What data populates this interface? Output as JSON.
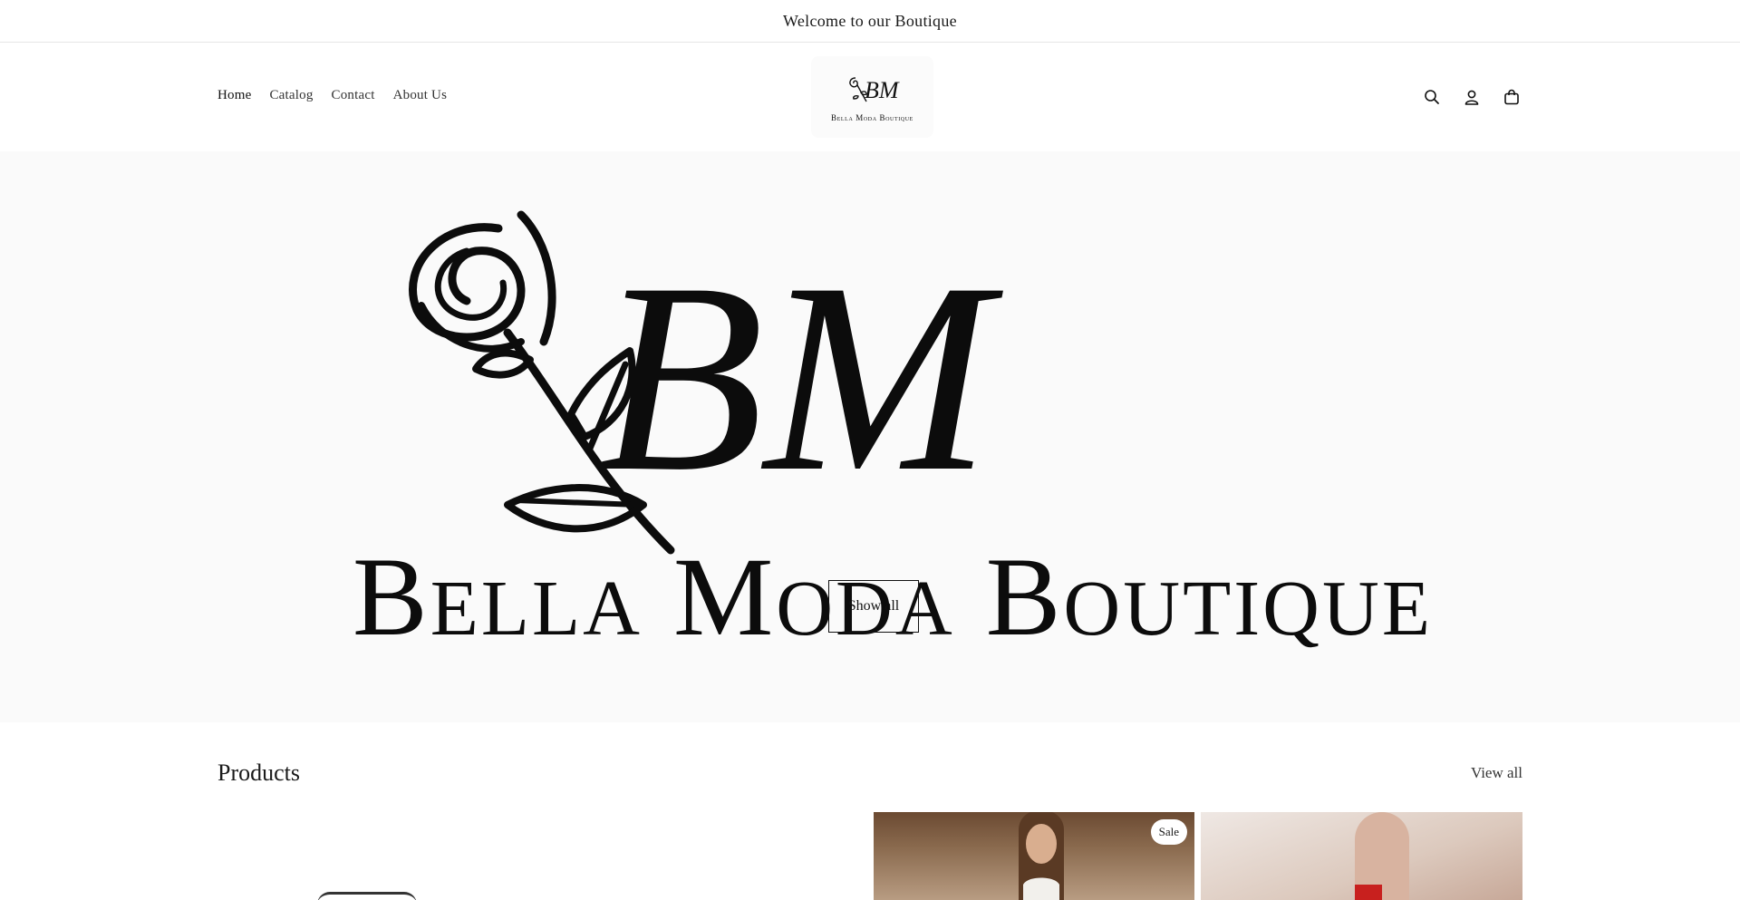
{
  "announcement": {
    "text": "Welcome to our Boutique"
  },
  "nav": {
    "items": [
      {
        "label": "Home"
      },
      {
        "label": "Catalog"
      },
      {
        "label": "Contact"
      },
      {
        "label": "About Us"
      }
    ]
  },
  "logo": {
    "monogram": "BM",
    "wordmark": "Bella Moda Boutique"
  },
  "header_icons": [
    "search-icon",
    "account-icon",
    "cart-icon"
  ],
  "hero": {
    "monogram": "BM",
    "wordmark": "Bella Moda Boutique",
    "button_label": "Show all"
  },
  "products": {
    "heading": "Products",
    "view_all": "View all",
    "badge": "Sale"
  },
  "colors": {
    "text": "#1a1a1a",
    "background": "#ffffff",
    "hero_background": "#fafafa",
    "accent_red": "#c8201e"
  }
}
